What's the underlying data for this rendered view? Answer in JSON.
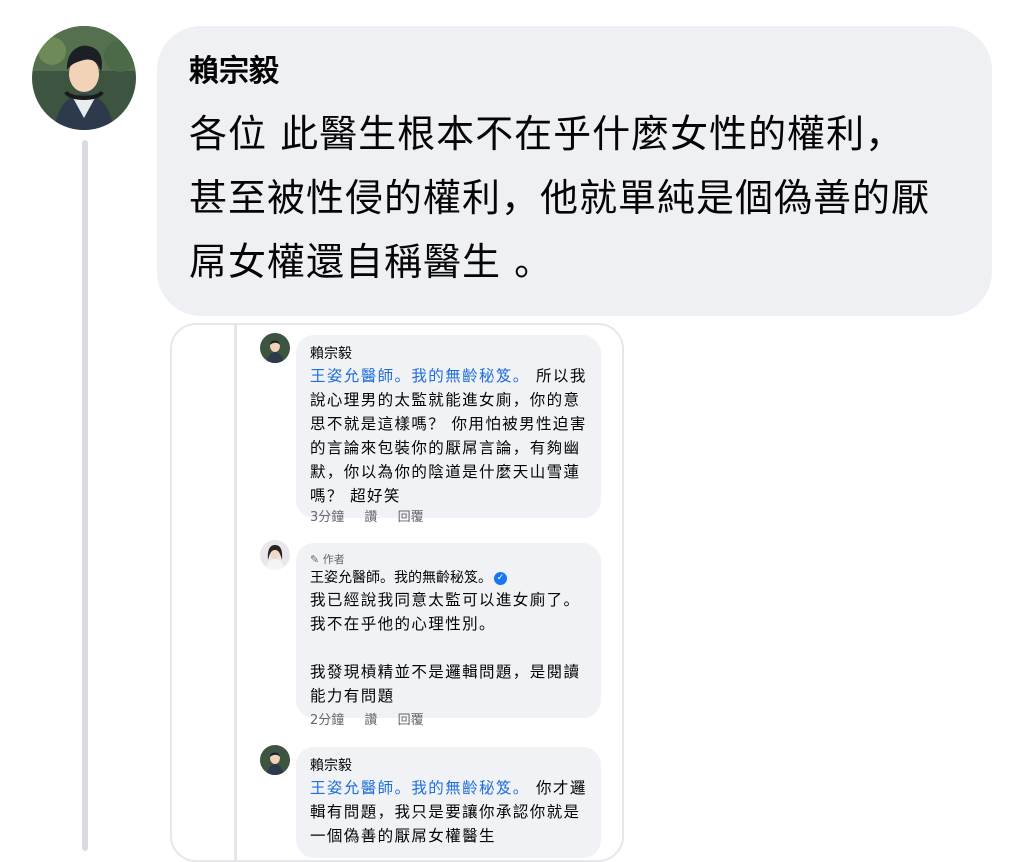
{
  "main_post": {
    "author": "賴宗毅",
    "text": "各位 此醫生根本不在乎什麼女性的權利，\n甚至被性侵的權利，他就單純是個偽善的厭\n屌女權還自稱醫生 。"
  },
  "embedded_screenshot": {
    "comments": [
      {
        "author": "賴宗毅",
        "mention": "王姿允醫師。我的無齡秘笈。",
        "text": " 所以我\n說心理男的太監就能進女廁，你的意\n思不就是這樣嗎？ 你用怕被男性迫害\n的言論來包裝你的厭屌言論，有夠幽\n默，你以為你的陰道是什麼天山雪蓮\n嗎？ 超好笑",
        "time": "3分鐘",
        "like": "讚",
        "reply": "回覆"
      },
      {
        "badge": "作者",
        "author": "王姿允醫師。我的無齡秘笈。",
        "text": "我已經說我同意太監可以進女廁了。\n我不在乎他的心理性別。\n\n我發現槓精並不是邏輯問題，是閱讀\n能力有問題",
        "time": "2分鐘",
        "like": "讚",
        "reply": "回覆"
      },
      {
        "author": "賴宗毅",
        "mention": "王姿允醫師。我的無齡秘笈。",
        "text": " 你才邏\n輯有問題，我只是要讓你承認你就是\n一個偽善的厭屌女權醫生"
      }
    ]
  },
  "colors": {
    "bubble": "#eff0f3",
    "mention": "#216fdb",
    "verified": "#1877f2",
    "meta_text": "#65676b"
  },
  "icons": [
    "pencil-icon",
    "verified-badge-icon"
  ]
}
